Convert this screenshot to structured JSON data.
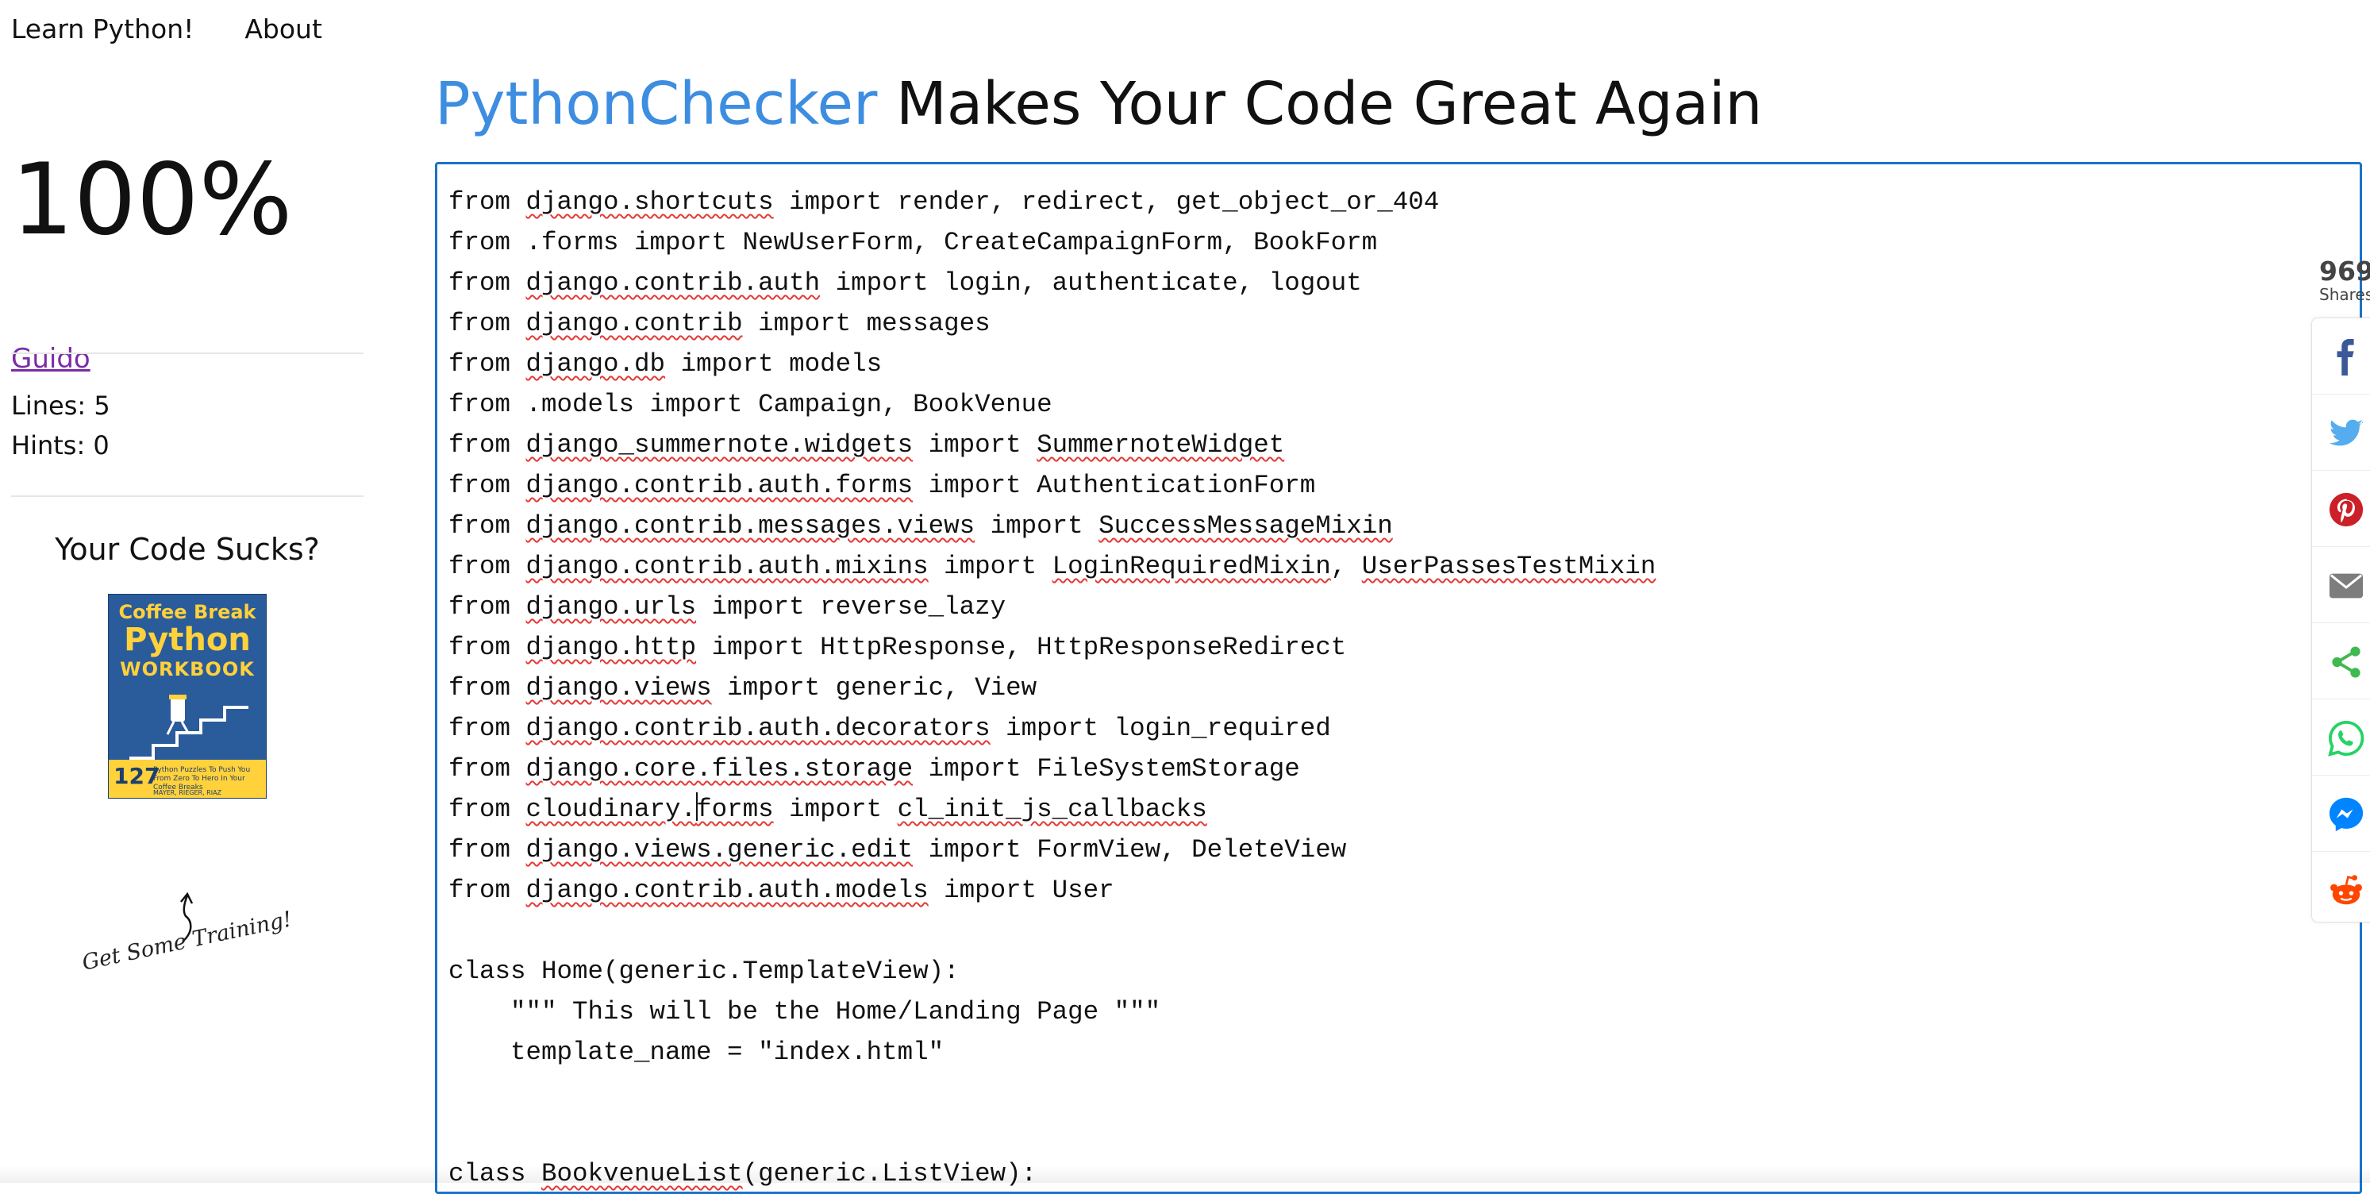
{
  "nav": {
    "learn": "Learn Python!",
    "about": "About"
  },
  "headline": {
    "brand": "PythonChecker",
    "rest": " Makes Your Code Great Again"
  },
  "sidebar": {
    "score": "100%",
    "author": "Guido",
    "lines_label": "Lines: 5",
    "hints_label": "Hints: 0",
    "promo_title": "Your Code Sucks?",
    "book": {
      "line1": "Coffee Break",
      "line2": "Python",
      "line3": "WORKBOOK",
      "number": "127",
      "subtitle": "Python Puzzles To Push You From Zero To Hero In Your Coffee Breaks",
      "authors": "MAYER, RIEGER, RIAZ"
    },
    "training": "Get Some Training!"
  },
  "editor": {
    "lines": [
      "from django.shortcuts import render, redirect, get_object_or_404",
      "from .forms import NewUserForm, CreateCampaignForm, BookForm",
      "from django.contrib.auth import login, authenticate, logout",
      "from django.contrib import messages",
      "from django.db import models",
      "from .models import Campaign, BookVenue",
      "from django_summernote.widgets import SummernoteWidget",
      "from django.contrib.auth.forms import AuthenticationForm",
      "from django.contrib.messages.views import SuccessMessageMixin",
      "from django.contrib.auth.mixins import LoginRequiredMixin, UserPassesTestMixin",
      "from django.urls import reverse_lazy",
      "from django.http import HttpResponse, HttpResponseRedirect",
      "from django.views import generic, View",
      "from django.contrib.auth.decorators import login_required",
      "from django.core.files.storage import FileSystemStorage",
      "from cloudinary.forms import cl_init_js_callbacks",
      "from django.views.generic.edit import FormView, DeleteView",
      "from django.contrib.auth.models import User",
      "",
      "class Home(generic.TemplateView):",
      "    \"\"\" This will be the Home/Landing Page \"\"\"",
      "    template_name = \"index.html\"",
      "",
      "",
      "class BookvenueList(generic.ListView):"
    ],
    "misspelled": [
      "django.shortcuts",
      "django.contrib.auth.forms",
      "django.contrib.auth.decorators",
      "django.contrib.auth.mixins",
      "django.contrib.auth.models",
      "django.contrib.auth",
      "django.contrib.messages.views",
      "django.contrib",
      "django.db",
      "django_summernote.widgets",
      "SummernoteWidget",
      "SuccessMessageMixin",
      "LoginRequiredMixin",
      "UserPassesTestMixin",
      "django.urls",
      "django.http",
      "django.views.generic.edit",
      "django.views",
      "django.core.files.storage",
      "cloudinary.forms",
      "cl_init_js_callbacks",
      "BookvenueList"
    ]
  },
  "share": {
    "count": "969",
    "label": "Shares",
    "colors": {
      "facebook": "#3b5998",
      "twitter": "#55acee",
      "pinterest": "#cb2027",
      "email": "#7d7d7d",
      "sharethis": "#3fb950",
      "whatsapp": "#25d366",
      "messenger": "#0084ff",
      "reddit": "#ff4500"
    }
  }
}
